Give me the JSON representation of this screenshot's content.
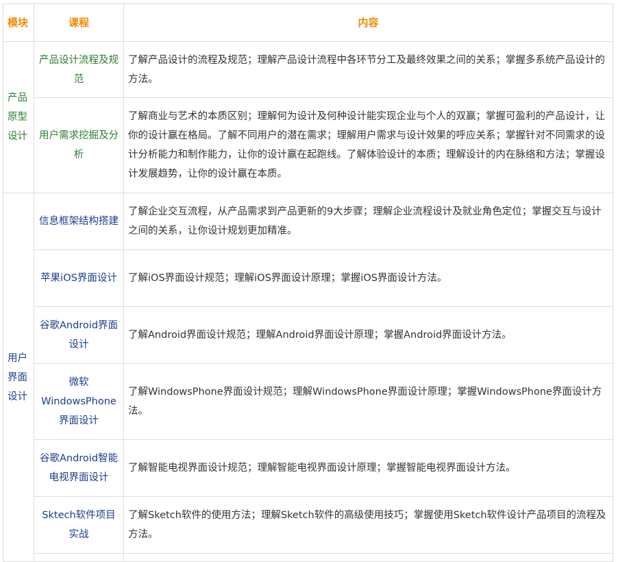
{
  "header": {
    "module": "模块",
    "course": "课程",
    "content": "内容"
  },
  "modules": [
    {
      "name": "产品原型设计",
      "rows": [
        {
          "course": "产品设计流程及规范",
          "content": "了解产品设计的流程及规范；理解产品设计流程中各环节分工及最终效果之间的关系；掌握多系统产品设计的方法。"
        },
        {
          "course": "用户需求挖掘及分析",
          "content": "了解商业与艺术的本质区别；理解何为设计及何种设计能实现企业与个人的双赢；掌握可盈利的产品设计，让你的设计赢在格局。了解不同用户的潜在需求；理解用户需求与设计效果的呼应关系；掌握针对不同需求的设计分析能力和制作能力，让你的设计赢在起跑线。了解体验设计的本质；理解设计的内在脉络和方法；掌握设计发展趋势，让你的设计赢在本质。"
        }
      ]
    },
    {
      "name": "用户界面设计",
      "rows": [
        {
          "course": "信息框架结构搭建",
          "content": "了解企业交互流程，从产品需求到产品更新的9大步骤；理解企业流程设计及就业角色定位；掌握交互与设计之间的关系，让你设计规划更加精准。"
        },
        {
          "course": "苹果iOS界面设计",
          "content": "了解iOS界面设计规范；理解iOS界面设计原理；掌握iOS界面设计方法。"
        },
        {
          "course": "谷歌Android界面设计",
          "content": "了解Android界面设计规范；理解Android界面设计原理；掌握Android界面设计方法。"
        },
        {
          "course": "微软WindowsPhone界面设计",
          "content": "了解WindowsPhone界面设计规范；理解WindowsPhone界面设计原理；掌握WindowsPhone界面设计方法。"
        },
        {
          "course": "谷歌Android智能电视界面设计",
          "content": "了解智能电视界面设计规范；理解智能电视界面设计原理；掌握智能电视界面设计方法。"
        },
        {
          "course": "Sktech软件项目实战",
          "content": "了解Sketch软件的使用方法；理解Sketch软件的高级使用技巧；掌握使用Sketch软件设计产品项目的流程及方法。"
        }
      ]
    }
  ]
}
